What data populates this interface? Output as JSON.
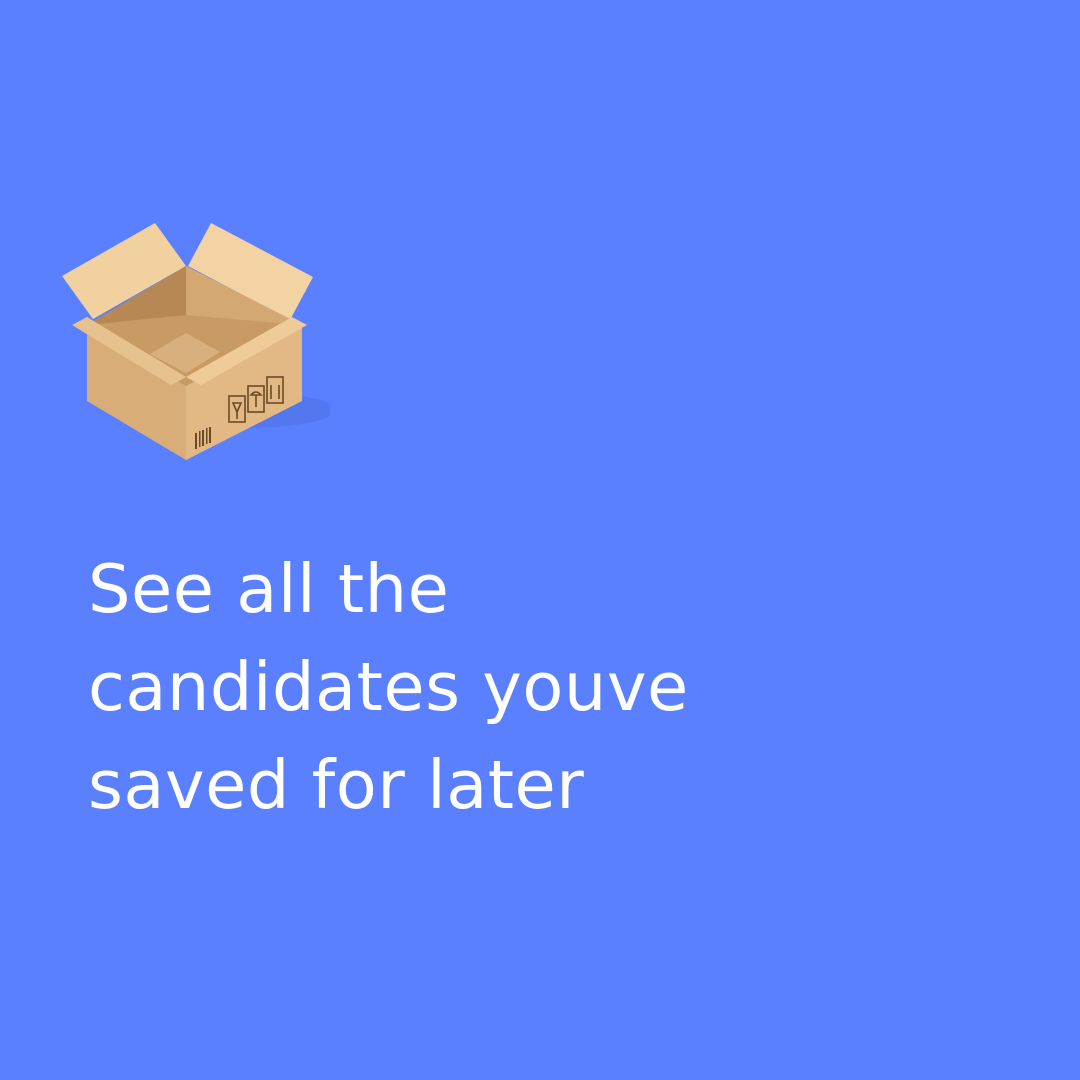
{
  "background_color": "#5b80ff",
  "text_color": "#ffffff",
  "illustration": {
    "icon": "open-cardboard-box-icon"
  },
  "headline": {
    "lines": [
      "See all the",
      "candidates youve",
      "saved for later"
    ]
  }
}
